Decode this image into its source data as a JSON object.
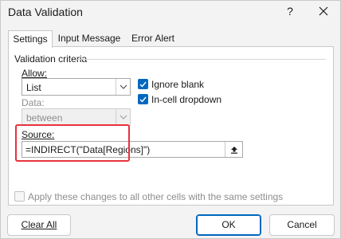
{
  "window": {
    "title": "Data Validation",
    "help_label": "?"
  },
  "tabs": [
    {
      "label": "Settings",
      "active": true
    },
    {
      "label": "Input Message",
      "active": false
    },
    {
      "label": "Error Alert",
      "active": false
    }
  ],
  "criteria": {
    "group_label": "Validation criteria",
    "allow_label": "Allow:",
    "allow_value": "List",
    "data_label": "Data:",
    "data_value": "between",
    "ignore_blank_label": "Ignore blank",
    "ignore_blank_checked": true,
    "in_cell_dropdown_label": "In-cell dropdown",
    "in_cell_dropdown_checked": true,
    "source_label": "Source:",
    "source_value": "=INDIRECT(\"Data[Regions]\")"
  },
  "apply_all": {
    "label": "Apply these changes to all other cells with the same settings",
    "checked": false
  },
  "buttons": {
    "clear_all": "Clear All",
    "ok": "OK",
    "cancel": "Cancel"
  },
  "icons": {
    "close": "close-icon",
    "dropdown": "chevron-down-icon",
    "check": "checkmark-icon",
    "collapse": "collapse-dialog-icon"
  },
  "colors": {
    "accent": "#0067c0",
    "highlight": "#e8323c"
  }
}
